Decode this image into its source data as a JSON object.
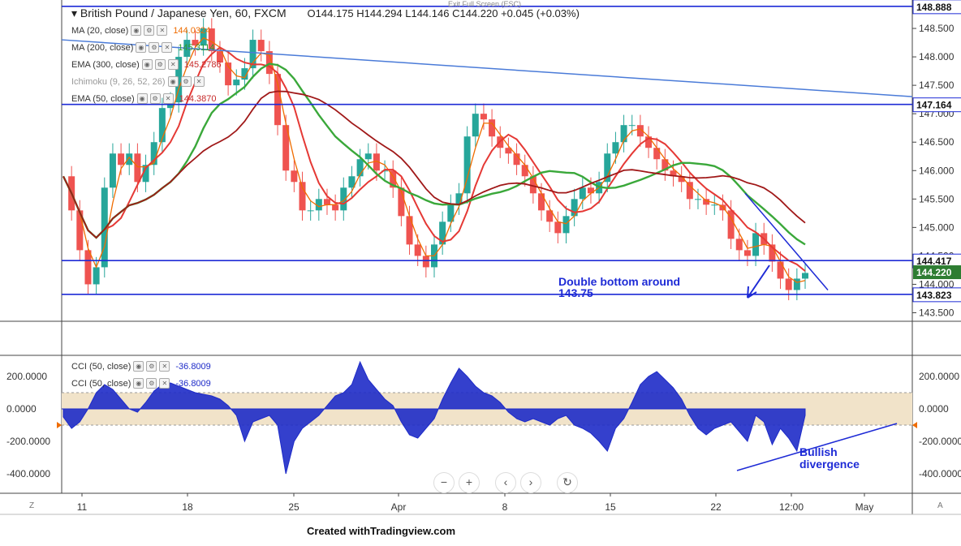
{
  "header": {
    "symbol": "British Pound / Japanese Yen, 60, FXCM",
    "ohlc": "O144.175  H144.294  L144.146  C144.220  +0.045 (+0.03%)",
    "exit_fullscreen": "Exit Full Screen (ESC)"
  },
  "indicators": [
    {
      "label": "MA (20, close)",
      "value": "144.0324",
      "color": "#ef6c00"
    },
    {
      "label": "MA (200, close)",
      "value": "145.3114",
      "color": "#2e9c2e"
    },
    {
      "label": "EMA (300, close)",
      "value": "145.2786",
      "color": "#c62828"
    },
    {
      "label": "Ichimoku (9, 26, 52, 26)",
      "value": "",
      "color": "#888888"
    },
    {
      "label": "EMA (50, close)",
      "value": "144.3870",
      "color": "#c62828"
    }
  ],
  "cci_legend": [
    {
      "label": "CCI (50, close)",
      "value": "-36.8009"
    },
    {
      "label": "CCI (50, close)",
      "value": "-36.8009"
    }
  ],
  "icons": [
    "eye-icon",
    "gear-icon",
    "close-icon",
    "zoom-out-icon",
    "zoom-in-icon",
    "chevron-left-icon",
    "chevron-right-icon",
    "reset-icon"
  ],
  "nav": {
    "minus": "−",
    "plus": "+",
    "left": "‹",
    "right": "›",
    "reset": "↻"
  },
  "corners": {
    "left": "Z",
    "right": "A"
  },
  "credit": "Created withTradingview.com",
  "colors": {
    "candle_up": "#26a69a",
    "candle_down": "#ef5350",
    "level_line": "#1e2bd6",
    "trend_line": "#4a7bd8",
    "cci_fill": "#1e2bc8",
    "band": "#f1e3c9"
  },
  "chart_data": [
    {
      "type": "line",
      "title": "British Pound / Japanese Yen, 60, FXCM",
      "xlabel": "",
      "ylabel": "",
      "x_ticks": [
        "11",
        "18",
        "25",
        "Apr",
        "8",
        "15",
        "22",
        "12:00",
        "May"
      ],
      "y_ticks": [
        143.5,
        144.0,
        144.5,
        145.0,
        145.5,
        146.0,
        146.5,
        147.0,
        147.5,
        148.0,
        148.5
      ],
      "ylim": [
        143.35,
        149.0
      ],
      "price_labels": [
        {
          "value": 148.888,
          "label": "148.888",
          "style": "level"
        },
        {
          "value": 147.164,
          "label": "147.164",
          "style": "level"
        },
        {
          "value": 144.417,
          "label": "144.417",
          "style": "level"
        },
        {
          "value": 144.22,
          "label": "144.220",
          "style": "current"
        },
        {
          "value": 143.823,
          "label": "143.823",
          "style": "level"
        }
      ],
      "annotations": [
        {
          "text": "Double bottom around 143.75"
        }
      ],
      "series": [
        {
          "values": [
            145.9,
            145.3,
            144.6,
            144.0,
            144.3,
            145.7,
            146.3,
            146.1,
            146.3,
            145.8,
            146.1,
            146.5,
            147.1,
            147.2,
            148.0,
            148.3,
            148.2,
            148.5,
            148.1,
            147.9,
            147.5,
            147.6,
            147.8,
            148.3,
            148.1,
            147.7,
            146.8,
            146.0,
            145.8,
            145.3,
            145.3,
            145.5,
            145.4,
            145.3,
            145.7,
            145.9,
            146.2,
            146.3,
            146.0,
            146.0,
            145.7,
            145.2,
            144.7,
            144.5,
            144.3,
            144.7,
            145.1,
            145.4,
            145.6,
            146.6,
            147.0,
            146.9,
            146.6,
            146.4,
            146.3,
            146.1,
            145.9,
            145.6,
            145.3,
            145.1,
            144.9,
            145.2,
            145.5,
            145.7,
            145.6,
            145.8,
            146.3,
            146.5,
            146.8,
            146.8,
            146.6,
            146.4,
            146.2,
            146.0,
            145.9,
            145.8,
            145.5,
            145.5,
            145.4,
            145.4,
            145.3,
            144.8,
            144.6,
            144.5,
            144.9,
            144.7,
            144.4,
            144.1,
            143.9,
            144.1,
            144.2
          ]
        }
      ]
    },
    {
      "type": "area",
      "title": "CCI (50, close)",
      "xlabel": "",
      "ylabel": "",
      "y_ticks": [
        200,
        0,
        -200,
        -400
      ],
      "ylim": [
        -520,
        330
      ],
      "band": [
        -100,
        100
      ],
      "annotations": [
        {
          "text": "Bullish divergence"
        }
      ],
      "series": [
        {
          "values": [
            -50,
            -120,
            -80,
            0,
            100,
            150,
            120,
            60,
            0,
            -20,
            40,
            110,
            150,
            160,
            140,
            120,
            100,
            90,
            80,
            60,
            20,
            -40,
            -200,
            -80,
            -60,
            -40,
            -100,
            -400,
            -200,
            -120,
            -80,
            -40,
            20,
            80,
            100,
            150,
            290,
            180,
            120,
            60,
            20,
            -80,
            -160,
            -180,
            -120,
            -60,
            60,
            160,
            250,
            200,
            140,
            100,
            80,
            40,
            -20,
            -60,
            -80,
            -60,
            -80,
            -100,
            -60,
            -40,
            -100,
            -120,
            -150,
            -200,
            -260,
            -120,
            -60,
            40,
            150,
            200,
            230,
            180,
            130,
            60,
            -40,
            -120,
            -160,
            -120,
            -100,
            -80,
            -140,
            -200,
            -40,
            -80,
            -220,
            -120,
            -180,
            -260,
            -40
          ]
        }
      ]
    }
  ]
}
